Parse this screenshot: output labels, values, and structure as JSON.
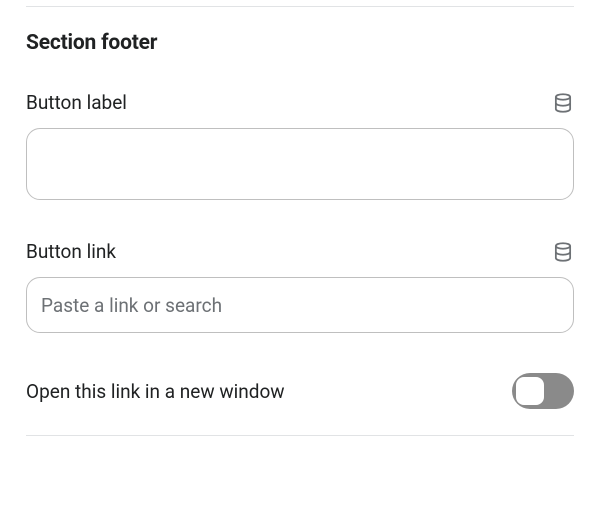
{
  "section": {
    "title": "Section footer"
  },
  "button_label_field": {
    "label": "Button label",
    "value": "",
    "icon": "database-icon"
  },
  "button_link_field": {
    "label": "Button link",
    "value": "",
    "placeholder": "Paste a link or search",
    "icon": "database-icon"
  },
  "open_new_window": {
    "label": "Open this link in a new window",
    "value": false
  }
}
